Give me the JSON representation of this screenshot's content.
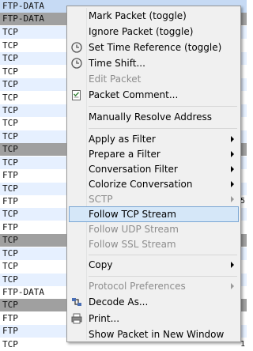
{
  "colors": {
    "selected_row": "#c6daf4",
    "gray_row": "#a0a0a0",
    "alt_row": "#e6f0ff",
    "menu_bg": "#f0f0f0",
    "menu_highlight": "#d5e7f8"
  },
  "packet_list": {
    "rows": [
      {
        "protocol": "FTP-DATA",
        "style": "selected",
        "edge": ""
      },
      {
        "protocol": "FTP-DATA",
        "style": "gray",
        "edge": ""
      },
      {
        "protocol": "TCP",
        "style": "blue",
        "edge": ""
      },
      {
        "protocol": "TCP",
        "style": "white",
        "edge": ""
      },
      {
        "protocol": "TCP",
        "style": "blue",
        "edge": ""
      },
      {
        "protocol": "TCP",
        "style": "white",
        "edge": ""
      },
      {
        "protocol": "TCP",
        "style": "blue",
        "edge": ""
      },
      {
        "protocol": "TCP",
        "style": "white",
        "edge": ""
      },
      {
        "protocol": "TCP",
        "style": "blue",
        "edge": ""
      },
      {
        "protocol": "TCP",
        "style": "white",
        "edge": ""
      },
      {
        "protocol": "TCP",
        "style": "blue",
        "edge": ""
      },
      {
        "protocol": "TCP",
        "style": "gray",
        "edge": ""
      },
      {
        "protocol": "TCP",
        "style": "blue",
        "edge": ""
      },
      {
        "protocol": "FTP",
        "style": "white",
        "edge": ""
      },
      {
        "protocol": "TCP",
        "style": "blue",
        "edge": ""
      },
      {
        "protocol": "FTP",
        "style": "white",
        "edge": "5"
      },
      {
        "protocol": "TCP",
        "style": "blue",
        "edge": ""
      },
      {
        "protocol": "FTP",
        "style": "white",
        "edge": ""
      },
      {
        "protocol": "TCP",
        "style": "gray",
        "edge": ""
      },
      {
        "protocol": "TCP",
        "style": "blue",
        "edge": ""
      },
      {
        "protocol": "TCP",
        "style": "white",
        "edge": ""
      },
      {
        "protocol": "TCP",
        "style": "blue",
        "edge": ""
      },
      {
        "protocol": "FTP-DATA",
        "style": "white",
        "edge": ""
      },
      {
        "protocol": "TCP",
        "style": "gray",
        "edge": ""
      },
      {
        "protocol": "FTP",
        "style": "white",
        "edge": ""
      },
      {
        "protocol": "FTP",
        "style": "blue",
        "edge": ""
      },
      {
        "protocol": "TCP",
        "style": "white",
        "edge": "1"
      }
    ]
  },
  "context_menu": {
    "items": [
      {
        "label": "Mark Packet (toggle)",
        "icon": "",
        "disabled": false,
        "submenu": false
      },
      {
        "label": "Ignore Packet (toggle)",
        "icon": "",
        "disabled": false,
        "submenu": false
      },
      {
        "label": "Set Time Reference (toggle)",
        "icon": "clock-icon",
        "disabled": false,
        "submenu": false
      },
      {
        "label": "Time Shift...",
        "icon": "clock-icon",
        "disabled": false,
        "submenu": false
      },
      {
        "label": "Edit Packet",
        "icon": "",
        "disabled": true,
        "submenu": false
      },
      {
        "label": "Packet Comment...",
        "icon": "comment-icon",
        "disabled": false,
        "submenu": false
      },
      {
        "label": "Manually Resolve Address",
        "icon": "",
        "disabled": false,
        "submenu": false
      },
      {
        "label": "Apply as Filter",
        "icon": "",
        "disabled": false,
        "submenu": true
      },
      {
        "label": "Prepare a Filter",
        "icon": "",
        "disabled": false,
        "submenu": true
      },
      {
        "label": "Conversation Filter",
        "icon": "",
        "disabled": false,
        "submenu": true
      },
      {
        "label": "Colorize Conversation",
        "icon": "",
        "disabled": false,
        "submenu": true
      },
      {
        "label": "SCTP",
        "icon": "",
        "disabled": true,
        "submenu": true
      },
      {
        "label": "Follow TCP Stream",
        "icon": "",
        "disabled": false,
        "submenu": false,
        "highlighted": true
      },
      {
        "label": "Follow UDP Stream",
        "icon": "",
        "disabled": true,
        "submenu": false
      },
      {
        "label": "Follow SSL Stream",
        "icon": "",
        "disabled": true,
        "submenu": false
      },
      {
        "label": "Copy",
        "icon": "",
        "disabled": false,
        "submenu": true
      },
      {
        "label": "Protocol Preferences",
        "icon": "",
        "disabled": true,
        "submenu": true
      },
      {
        "label": "Decode As...",
        "icon": "decode-icon",
        "disabled": false,
        "submenu": false
      },
      {
        "label": "Print...",
        "icon": "printer-icon",
        "disabled": false,
        "submenu": false
      },
      {
        "label": "Show Packet in New Window",
        "icon": "",
        "disabled": false,
        "submenu": false
      }
    ]
  }
}
